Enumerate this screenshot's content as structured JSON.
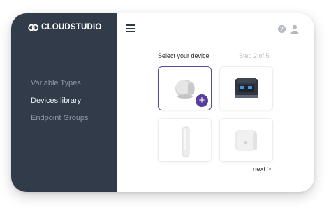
{
  "app": {
    "logo_text": "CLOUDSTUDIO"
  },
  "sidebar": {
    "items": [
      {
        "label": "Variable Types",
        "active": false
      },
      {
        "label": "Devices library",
        "active": true
      },
      {
        "label": "Endpoint Groups",
        "active": false
      }
    ]
  },
  "header": {
    "menu_icon": "hamburger-icon",
    "help_icon": "help-icon",
    "user_icon": "user-icon",
    "help_glyph": "?"
  },
  "wizard": {
    "title": "Select your device",
    "step": "Step 2 of 5",
    "next_label": "next >",
    "devices": [
      {
        "icon": "dome-sensor-icon",
        "selected": true
      },
      {
        "icon": "relay-module-icon",
        "selected": false
      },
      {
        "icon": "tube-sensor-icon",
        "selected": false
      },
      {
        "icon": "box-sensor-icon",
        "selected": false
      }
    ],
    "add_glyph": "+"
  },
  "colors": {
    "sidebar_bg": "#323b4a",
    "accent": "#5a3f9a",
    "selected_border": "#5b4a8f"
  }
}
